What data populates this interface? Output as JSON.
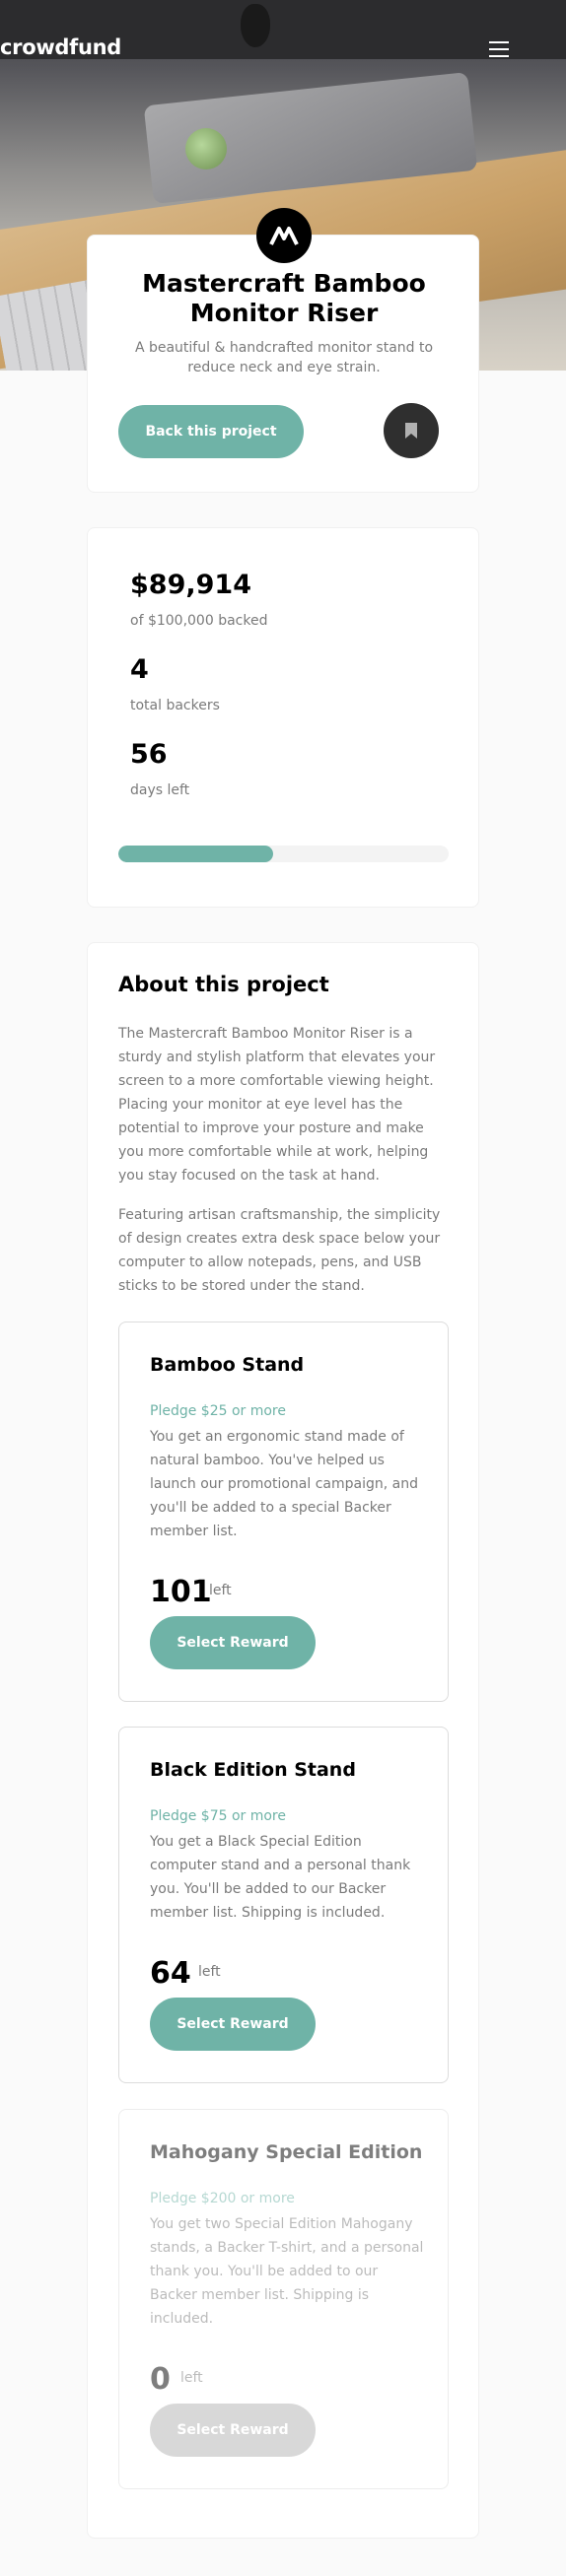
{
  "header": {
    "logo": "crowdfund",
    "menu_icon": "hamburger-menu-icon"
  },
  "intro": {
    "project_logo_icon": "mastercraft-logo-icon",
    "title": "Mastercraft Bamboo Monitor Riser",
    "description": "A beautiful & handcrafted monitor stand to reduce neck and eye strain.",
    "back_button": "Back this project",
    "bookmark_icon": "bookmark-icon"
  },
  "stats": {
    "backed_amount": "$89,914",
    "backed_label": "of $100,000 backed",
    "backers": "4",
    "backers_label": "total backers",
    "days_left": "56",
    "days_label": "days left",
    "progress_fraction": 0.47
  },
  "about": {
    "title": "About this project",
    "paragraph1": "The Mastercraft Bamboo Monitor Riser is a sturdy and stylish platform that elevates your screen to a more comfortable viewing height. Placing your monitor at eye level has the potential to improve your posture and make you more comfortable while at work, helping you stay focused on the task at hand.",
    "paragraph2": "Featuring artisan craftsmanship, the simplicity of design creates extra desk space below your computer to allow notepads, pens, and USB sticks to be stored under the stand."
  },
  "rewards": [
    {
      "name": "Bamboo Stand",
      "pledge": "Pledge $25 or more",
      "description": "You get an ergonomic stand made of natural bamboo. You've helped us launch our promotional campaign, and you'll be added to a special Backer member list.",
      "left": "101",
      "left_label": "left",
      "button": "Select Reward"
    },
    {
      "name": "Black Edition Stand",
      "pledge": "Pledge $75 or more",
      "description": "You get a Black Special Edition computer stand and a personal thank you. You'll be added to our Backer member list. Shipping is included.",
      "left": "64",
      "left_label": "left",
      "button": "Select Reward"
    },
    {
      "name": "Mahogany Special Edition",
      "pledge": "Pledge $200 or more",
      "description": "You get two Special Edition Mahogany stands, a Backer T-shirt, and a personal thank you. You'll be added to our Backer member list. Shipping is included.",
      "left": "0",
      "left_label": "left",
      "button": "Select Reward"
    }
  ],
  "colors": {
    "accent": "#6fb3a7",
    "dark": "#2f2f2f",
    "muted_text": "#7a7a7a"
  }
}
